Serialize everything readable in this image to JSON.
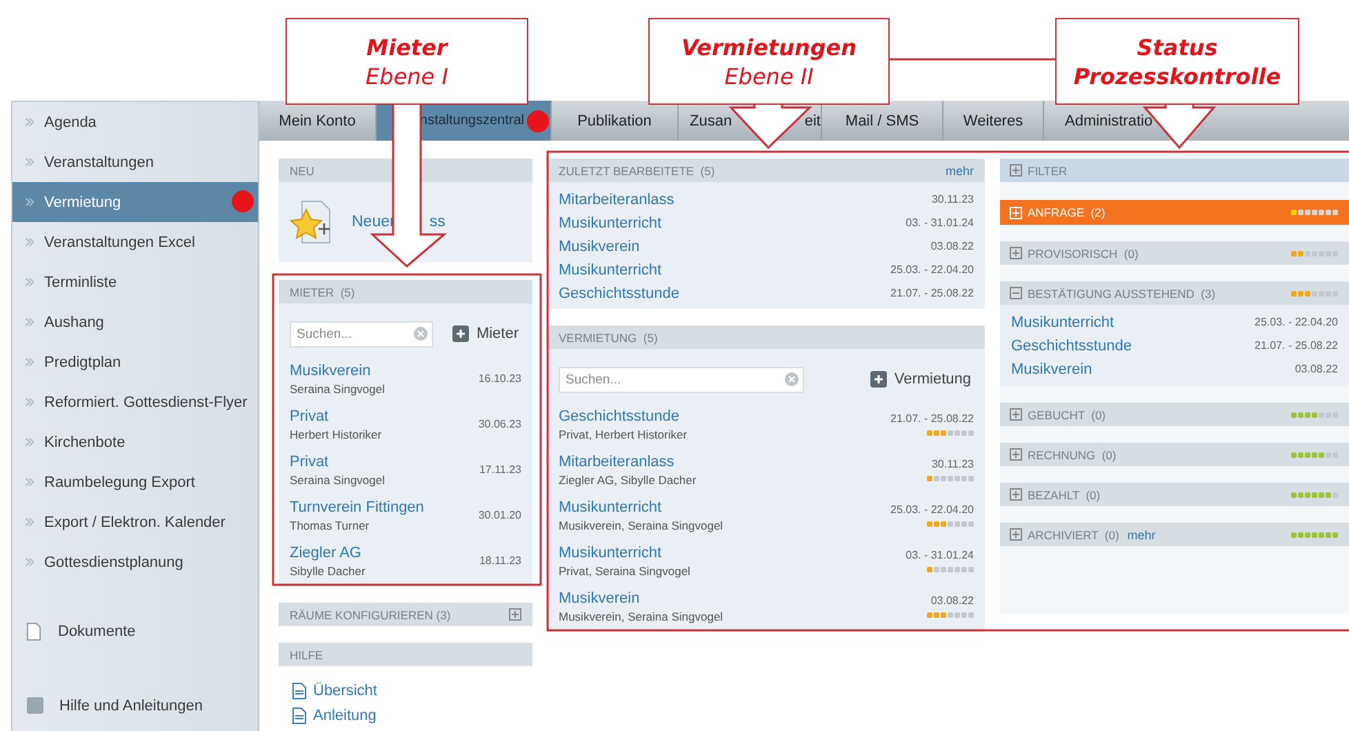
{
  "callouts": [
    {
      "lines": [
        {
          "text": "Mieter",
          "bold": true
        },
        {
          "text": "Ebene I",
          "bold": false
        }
      ]
    },
    {
      "lines": [
        {
          "text": "Vermietungen",
          "bold": true
        },
        {
          "text": "Ebene II",
          "bold": false
        }
      ]
    },
    {
      "lines": [
        {
          "text": "Status",
          "bold": true
        },
        {
          "text": "Prozesskontrolle",
          "bold": true
        }
      ]
    }
  ],
  "sidebar": {
    "items": [
      {
        "label": "Agenda",
        "kind": "link",
        "selected": false,
        "marked": false
      },
      {
        "label": "Veranstaltungen",
        "kind": "link",
        "selected": false,
        "marked": false
      },
      {
        "label": "Vermietung",
        "kind": "link",
        "selected": true,
        "marked": true
      },
      {
        "label": "Veranstaltungen Excel",
        "kind": "link",
        "selected": false,
        "marked": false
      },
      {
        "label": "Terminliste",
        "kind": "link",
        "selected": false,
        "marked": false
      },
      {
        "label": "Aushang",
        "kind": "link",
        "selected": false,
        "marked": false
      },
      {
        "label": "Predigtplan",
        "kind": "link",
        "selected": false,
        "marked": false
      },
      {
        "label": "Reformiert. Gottesdienst-Flyer",
        "kind": "link",
        "selected": false,
        "marked": false
      },
      {
        "label": "Kirchenbote",
        "kind": "link",
        "selected": false,
        "marked": false
      },
      {
        "label": "Raumbelegung Export",
        "kind": "link",
        "selected": false,
        "marked": false
      },
      {
        "label": "Export / Elektron. Kalender",
        "kind": "link",
        "selected": false,
        "marked": false
      },
      {
        "label": "Gottesdienstplanung",
        "kind": "link",
        "selected": false,
        "marked": false
      },
      {
        "label": "Dokumente",
        "kind": "document",
        "selected": false,
        "marked": false
      },
      {
        "label": "Hilfe und Anleitungen",
        "kind": "help",
        "selected": false,
        "marked": false
      }
    ]
  },
  "tabs": [
    {
      "label": "Mein Konto",
      "selected": false,
      "marked": false
    },
    {
      "label": "nstaltungszentral",
      "selected": true,
      "marked": true
    },
    {
      "label": "Publikation",
      "selected": false,
      "marked": false
    },
    {
      "label": "Zusan",
      "label_tail": "eit",
      "selected": false,
      "marked": false
    },
    {
      "label": "Mail / SMS",
      "selected": false,
      "marked": false
    },
    {
      "label": "Weiteres",
      "selected": false,
      "marked": false
    },
    {
      "label": "Administratio",
      "selected": false,
      "marked": false
    }
  ],
  "new_panel": {
    "title": "NEU",
    "action": "Neuer",
    "action_tail": "ss"
  },
  "tenants": {
    "title": "MIETER  (5)",
    "search": {
      "placeholder": "Suchen..."
    },
    "add_button": "Mieter",
    "rows": [
      {
        "name": "Musikverein",
        "contact": "Seraina Singvogel",
        "date": "16.10.23"
      },
      {
        "name": "Privat",
        "contact": "Herbert Historiker",
        "date": "30.06.23"
      },
      {
        "name": "Privat",
        "contact": "Seraina Singvogel",
        "date": "17.11.23"
      },
      {
        "name": "Turnverein Fittingen",
        "contact": "Thomas Turner",
        "date": "30.01.20"
      },
      {
        "name": "Ziegler AG",
        "contact": "Sibylle Dacher",
        "date": "18.11.23"
      }
    ]
  },
  "rooms": {
    "title": "RÄUME KONFIGURIEREN (3)",
    "expanded": false
  },
  "help": {
    "title": "HILFE",
    "links": [
      "Übersicht",
      "Anleitung"
    ]
  },
  "recent": {
    "title": "ZULETZT BEARBEITETE  (5)",
    "more": "mehr",
    "rows": [
      {
        "name": "Mitarbeiteranlass",
        "date": "30.11.23"
      },
      {
        "name": "Musikunterricht",
        "date": "03. - 31.01.24"
      },
      {
        "name": "Musikverein",
        "date": "03.08.22"
      },
      {
        "name": "Musikunterricht",
        "date": "25.03. - 22.04.20"
      },
      {
        "name": "Geschichtsstunde",
        "date": "21.07. - 25.08.22"
      }
    ]
  },
  "rentals": {
    "title": "VERMIETUNG  (5)",
    "search": {
      "placeholder": "Suchen..."
    },
    "add_button": "Vermietung",
    "rows": [
      {
        "name": "Geschichtsstunde",
        "detail": "Privat, Herbert Historiker",
        "date": "21.07. - 25.08.22",
        "stars": 3
      },
      {
        "name": "Mitarbeiteranlass",
        "detail": "Ziegler AG, Sibylle Dacher",
        "date": "30.11.23",
        "stars": 1
      },
      {
        "name": "Musikunterricht",
        "detail": "Musikverein, Seraina Singvogel",
        "date": "25.03. - 22.04.20",
        "stars": 3
      },
      {
        "name": "Musikunterricht",
        "detail": "Privat, Seraina Singvogel",
        "date": "03. - 31.01.24",
        "stars": 1
      },
      {
        "name": "Musikverein",
        "detail": "Musikverein, Seraina Singvogel",
        "date": "03.08.22",
        "stars": 3
      }
    ]
  },
  "status": {
    "sections": [
      {
        "kind": "filter",
        "label": "FILTER",
        "expanded": false,
        "active": false
      },
      {
        "kind": "status",
        "label": "ANFRAGE  (2)",
        "expanded": false,
        "active": true,
        "stars": 1
      },
      {
        "kind": "status",
        "label": "PROVISORISCH  (0)",
        "expanded": false,
        "active": false,
        "stars": 2
      },
      {
        "kind": "status",
        "label": "BESTÄTIGUNG AUSSTEHEND  (3)",
        "expanded": true,
        "active": false,
        "stars": 3,
        "rows": [
          {
            "name": "Musikunterricht",
            "date": "25.03. - 22.04.20"
          },
          {
            "name": "Geschichtsstunde",
            "date": "21.07. - 25.08.22"
          },
          {
            "name": "Musikverein",
            "date": "03.08.22"
          }
        ]
      },
      {
        "kind": "status",
        "label": "GEBUCHT  (0)",
        "expanded": false,
        "active": false,
        "stars": 4
      },
      {
        "kind": "status",
        "label": "RECHNUNG  (0)",
        "expanded": false,
        "active": false,
        "stars": 5
      },
      {
        "kind": "status",
        "label": "BEZAHLT  (0)",
        "expanded": false,
        "active": false,
        "stars": 6
      },
      {
        "kind": "status",
        "label": "ARCHIVIERT  (0)",
        "more": "mehr",
        "expanded": false,
        "active": false,
        "stars": 7
      }
    ]
  }
}
